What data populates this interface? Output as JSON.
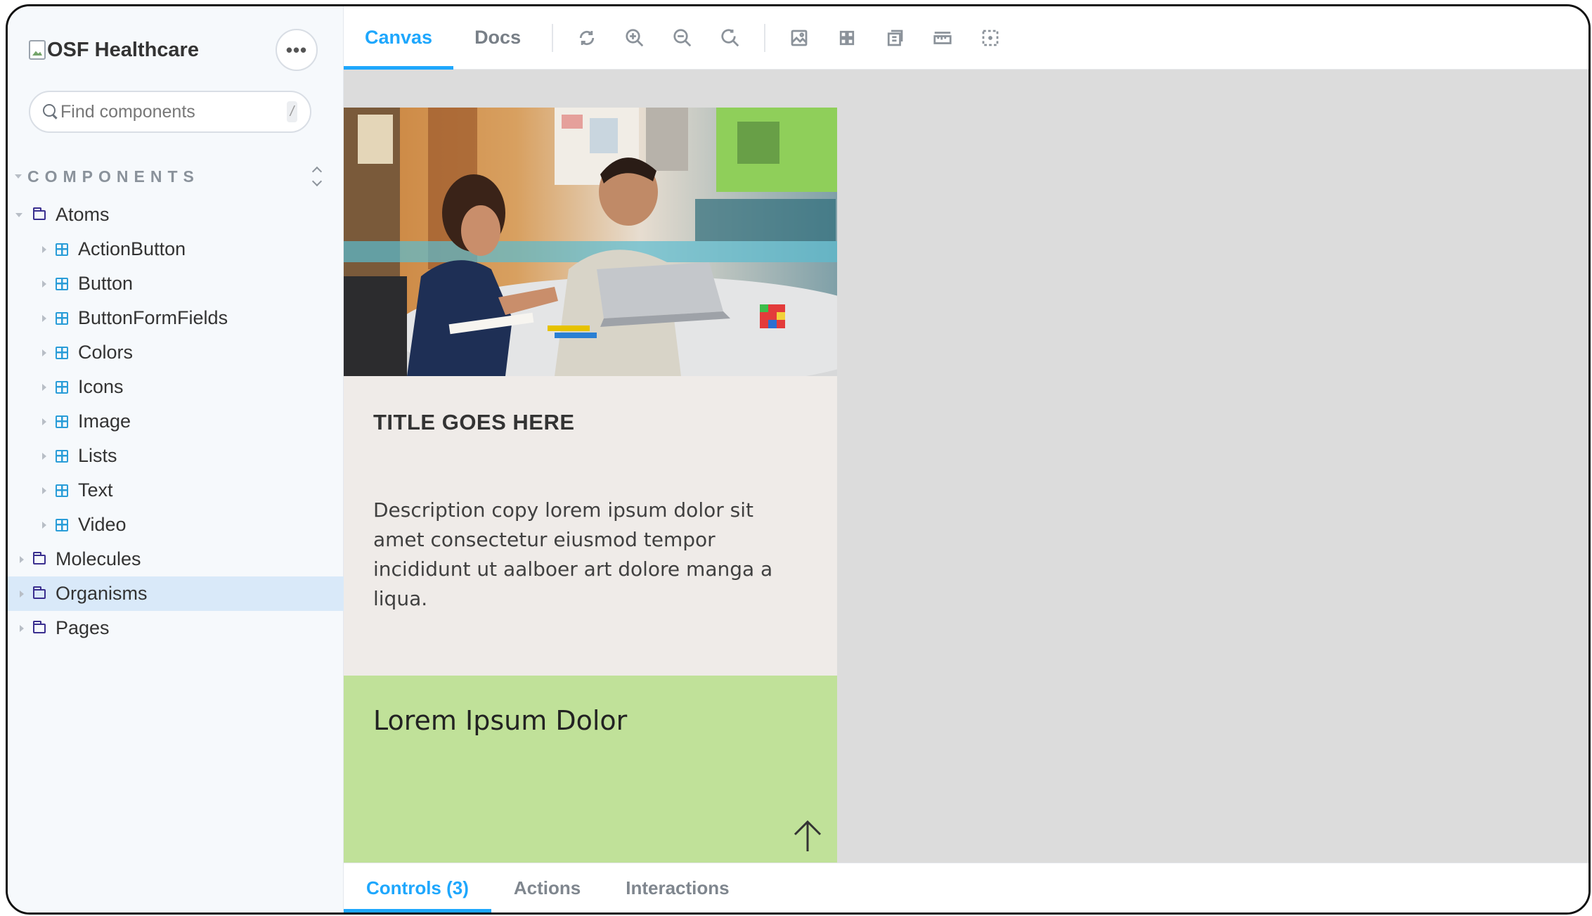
{
  "sidebar": {
    "brand": "OSF Healthcare",
    "more_label": "•••",
    "search": {
      "placeholder": "Find components",
      "shortcut": "/"
    },
    "section_title": "COMPONENTS",
    "tree": {
      "atoms": "Atoms",
      "atoms_children": [
        "ActionButton",
        "Button",
        "ButtonFormFields",
        "Colors",
        "Icons",
        "Image",
        "Lists",
        "Text",
        "Video"
      ],
      "molecules": "Molecules",
      "organisms": "Organisms",
      "pages": "Pages"
    },
    "selected": "Organisms"
  },
  "toolbar": {
    "tabs": [
      "Canvas",
      "Docs"
    ],
    "active_tab": "Canvas",
    "tools": [
      "reload-icon",
      "zoom-in-icon",
      "zoom-out-icon",
      "zoom-reset-icon",
      "background-icon",
      "grid-icon",
      "viewport-icon",
      "measure-icon",
      "outline-icon"
    ]
  },
  "card": {
    "title": "TITLE GOES HERE",
    "description": "Description copy lorem ipsum dolor sit amet consectetur eiusmod tempor incididunt ut aalboer art dolore manga a liqua.",
    "footer_title": "Lorem Ipsum Dolor"
  },
  "addons": {
    "tabs": [
      "Controls (3)",
      "Actions",
      "Interactions"
    ],
    "active_tab": "Controls (3)"
  },
  "colors": {
    "accent": "#1ea7fd",
    "sidebar_bg": "#f6f9fc",
    "canvas_bg": "#dcdcdc",
    "card_body_bg": "#efebe8",
    "card_footer_bg": "#c0e199",
    "selected_row": "#d9e9f9"
  }
}
